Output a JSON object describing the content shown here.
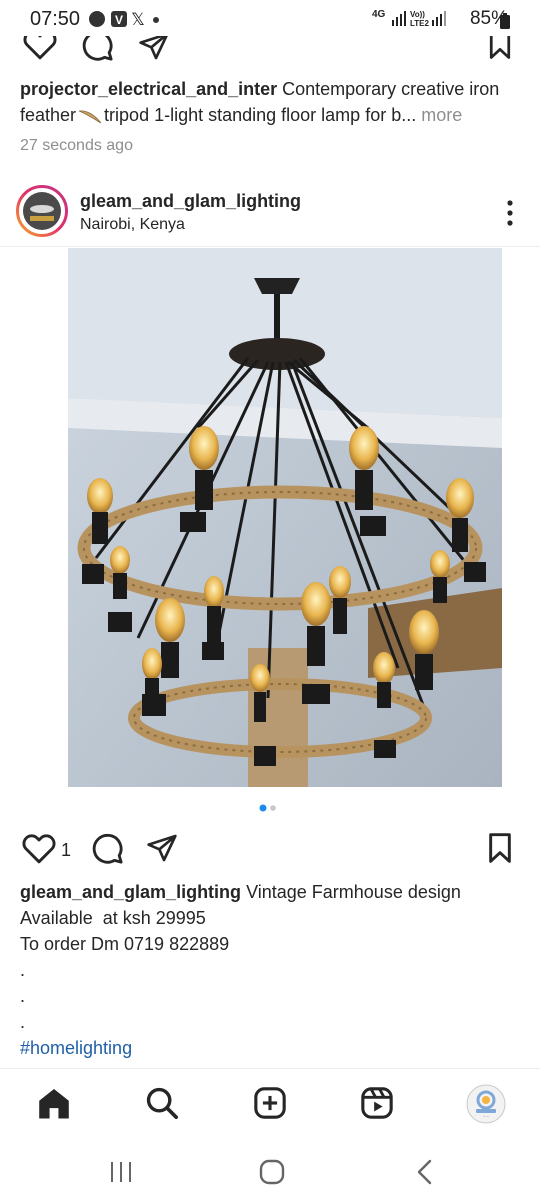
{
  "status_bar": {
    "time": "07:50",
    "net_4g": "4G",
    "volte": "Vo)) LTE2",
    "battery": "85%"
  },
  "prev_post": {
    "username": "projector_electrical_and_inter",
    "caption_line1": "Contemporary creative iron",
    "caption_line2a": "feather",
    "caption_line2b": "tripod 1-light standing floor lamp for b...",
    "more": "more",
    "time_ago": "27 seconds ago"
  },
  "post": {
    "username": "gleam_and_glam_lighting",
    "location": "Nairobi, Kenya",
    "like_count": "1",
    "caption_first": "Vintage Farmhouse design",
    "caption_line2": "Available  at ksh 29995",
    "caption_line3": "To order Dm 0719 822889",
    "dot": ".",
    "hashtag": "#homelighting",
    "carousel_total": 2,
    "carousel_active": 1
  },
  "icons": {
    "like": "heart-icon",
    "comment": "comment-icon",
    "share": "send-icon",
    "save": "bookmark-icon",
    "nav": [
      "home-icon",
      "search-icon",
      "create-icon",
      "reels-icon",
      "profile-avatar"
    ]
  },
  "colors": {
    "link": "#1f5fa6",
    "carousel_active": "#1a8cf0",
    "text": "#262626",
    "muted": "#8e8e8e"
  }
}
